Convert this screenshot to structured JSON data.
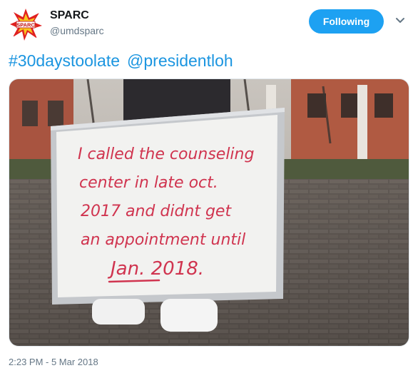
{
  "account": {
    "display_name": "SPARC",
    "handle": "@umdsparc",
    "avatar_icon": "sparc-logo-icon"
  },
  "follow_button": {
    "label": "Following",
    "color": "#1da1f2"
  },
  "menu_icon": "chevron-down-icon",
  "tweet": {
    "hashtag": "#30daystoolate",
    "mention": "@presidentloh",
    "link_color": "#1b95e0"
  },
  "media": {
    "sign_lines": [
      "I called the counseling",
      "center in late oct.",
      "2017 and didnt get",
      "an appointment until",
      "Jan. 2018."
    ],
    "ink_color": "#d0344f"
  },
  "timestamp": "2:23 PM - 5 Mar 2018"
}
